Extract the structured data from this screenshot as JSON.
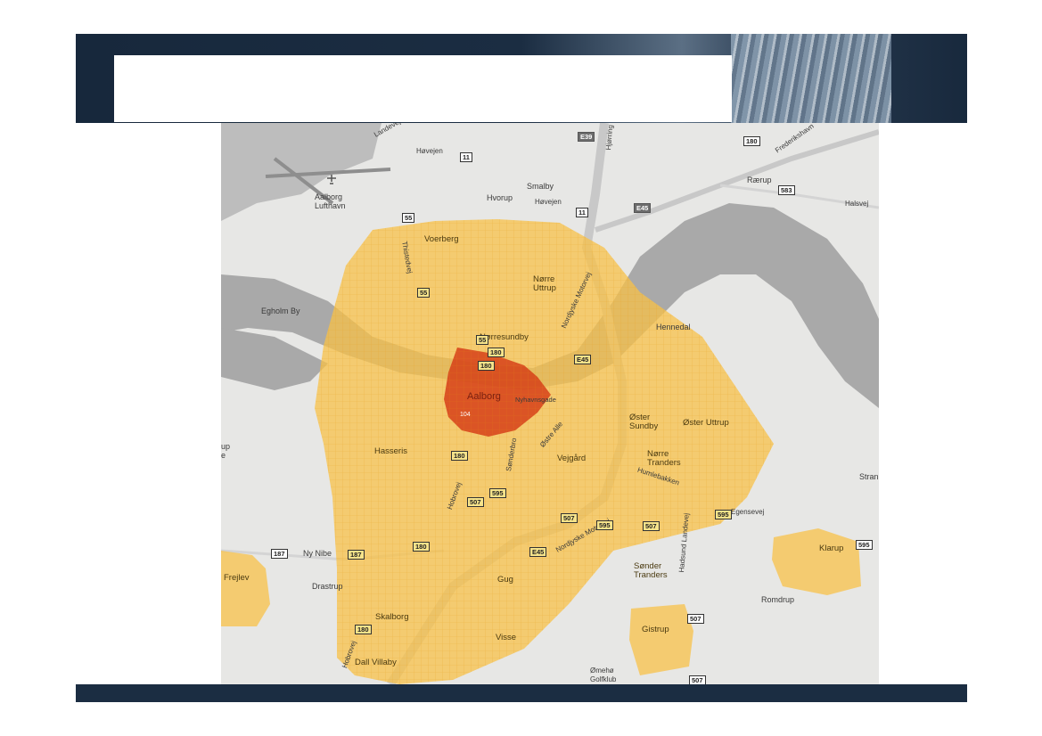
{
  "slide": {
    "title": ""
  },
  "map": {
    "places": [
      {
        "id": "aalborg-lufthavn",
        "text": "Aalborg\nLufthavn"
      },
      {
        "id": "smalby",
        "text": "Smalby"
      },
      {
        "id": "hvorup",
        "text": "Hvorup"
      },
      {
        "id": "voerberg",
        "text": "Voerberg"
      },
      {
        "id": "norre-uttrup",
        "text": "Nørre\nUttrup"
      },
      {
        "id": "egholm-by",
        "text": "Egholm By"
      },
      {
        "id": "norresundby",
        "text": "Nørresundby"
      },
      {
        "id": "hennedal",
        "text": "Hennedal"
      },
      {
        "id": "aalborg",
        "text": "Aalborg"
      },
      {
        "id": "oster-sundby",
        "text": "Øster\nSundby"
      },
      {
        "id": "oster-uttrup",
        "text": "Øster Uttrup"
      },
      {
        "id": "hasseris",
        "text": "Hasseris"
      },
      {
        "id": "vejgard",
        "text": "Vejgård"
      },
      {
        "id": "norre-tranders",
        "text": "Nørre\nTranders"
      },
      {
        "id": "humlebakken",
        "text": "Humlebakken"
      },
      {
        "id": "ny-nibe",
        "text": "Ny Nibe"
      },
      {
        "id": "frejlev",
        "text": "Frejlev"
      },
      {
        "id": "drastrup",
        "text": "Drastrup"
      },
      {
        "id": "gug",
        "text": "Gug"
      },
      {
        "id": "sonder-tranders",
        "text": "Sønder\nTranders"
      },
      {
        "id": "klarup",
        "text": "Klarup"
      },
      {
        "id": "romdrup",
        "text": "Romdrup"
      },
      {
        "id": "skalborg",
        "text": "Skalborg"
      },
      {
        "id": "gistrup",
        "text": "Gistrup"
      },
      {
        "id": "visse",
        "text": "Visse"
      },
      {
        "id": "dall-villaby",
        "text": "Dall Villaby"
      },
      {
        "id": "omeho-golfklub",
        "text": "Ømehø\nGolfklub"
      },
      {
        "id": "raerup",
        "text": "Rærup"
      },
      {
        "id": "up-edge",
        "text": "up\ne"
      },
      {
        "id": "stran-edge",
        "text": "Stran"
      }
    ],
    "roads": [
      {
        "id": "hovejen",
        "text": "Høvejen"
      },
      {
        "id": "hovejen-2",
        "text": "Høvejen"
      },
      {
        "id": "halsvej",
        "text": "Halsvej"
      },
      {
        "id": "egensevej",
        "text": "Egensevej"
      },
      {
        "id": "hadsund-landevej",
        "text": "Hadsund Landevej"
      },
      {
        "id": "hobrovej",
        "text": "Hobrovej"
      },
      {
        "id": "hobrovej-2",
        "text": "Hobrovej"
      },
      {
        "id": "thistedvej",
        "text": "Thistedvej"
      },
      {
        "id": "nordjyske-motorvej",
        "text": "Nordjyske Motorvej"
      },
      {
        "id": "nordjyske-motorvej-2",
        "text": "Nordjyske Motorvej"
      },
      {
        "id": "sonderbro",
        "text": "Sønderbro"
      },
      {
        "id": "ostre-alle",
        "text": "Østre Alle"
      },
      {
        "id": "nyhavnsgade",
        "text": "Nyhavnsgade"
      },
      {
        "id": "frederikshavnsvej",
        "text": "Frederikshavn"
      },
      {
        "id": "hjorring",
        "text": "Hjørring"
      },
      {
        "id": "landevej",
        "text": "Landevej"
      }
    ],
    "shields": [
      {
        "id": "s11a",
        "text": "11"
      },
      {
        "id": "s11b",
        "text": "11"
      },
      {
        "id": "s55a",
        "text": "55"
      },
      {
        "id": "s55b",
        "text": "55"
      },
      {
        "id": "s55c",
        "text": "55"
      },
      {
        "id": "s180a",
        "text": "180"
      },
      {
        "id": "s180b",
        "text": "180"
      },
      {
        "id": "s180c",
        "text": "180"
      },
      {
        "id": "s180d",
        "text": "180"
      },
      {
        "id": "s180e",
        "text": "180"
      },
      {
        "id": "s180f",
        "text": "180"
      },
      {
        "id": "s583",
        "text": "583"
      },
      {
        "id": "e39",
        "text": "E39"
      },
      {
        "id": "e45a",
        "text": "E45"
      },
      {
        "id": "e45b",
        "text": "E45"
      },
      {
        "id": "e45c",
        "text": "E45"
      },
      {
        "id": "s187a",
        "text": "187"
      },
      {
        "id": "s187b",
        "text": "187"
      },
      {
        "id": "s595a",
        "text": "595"
      },
      {
        "id": "s595b",
        "text": "595"
      },
      {
        "id": "s595c",
        "text": "595"
      },
      {
        "id": "s595d",
        "text": "595"
      },
      {
        "id": "s507a",
        "text": "507"
      },
      {
        "id": "s507b",
        "text": "507"
      },
      {
        "id": "s507c",
        "text": "507"
      },
      {
        "id": "s507d",
        "text": "507"
      },
      {
        "id": "s507e",
        "text": "507"
      },
      {
        "id": "s104",
        "text": "104"
      }
    ],
    "colors": {
      "water": "#a9a9a9",
      "land": "#e7e7e5",
      "zone_yellow": "#f8c248",
      "zone_red": "#d64018"
    }
  }
}
